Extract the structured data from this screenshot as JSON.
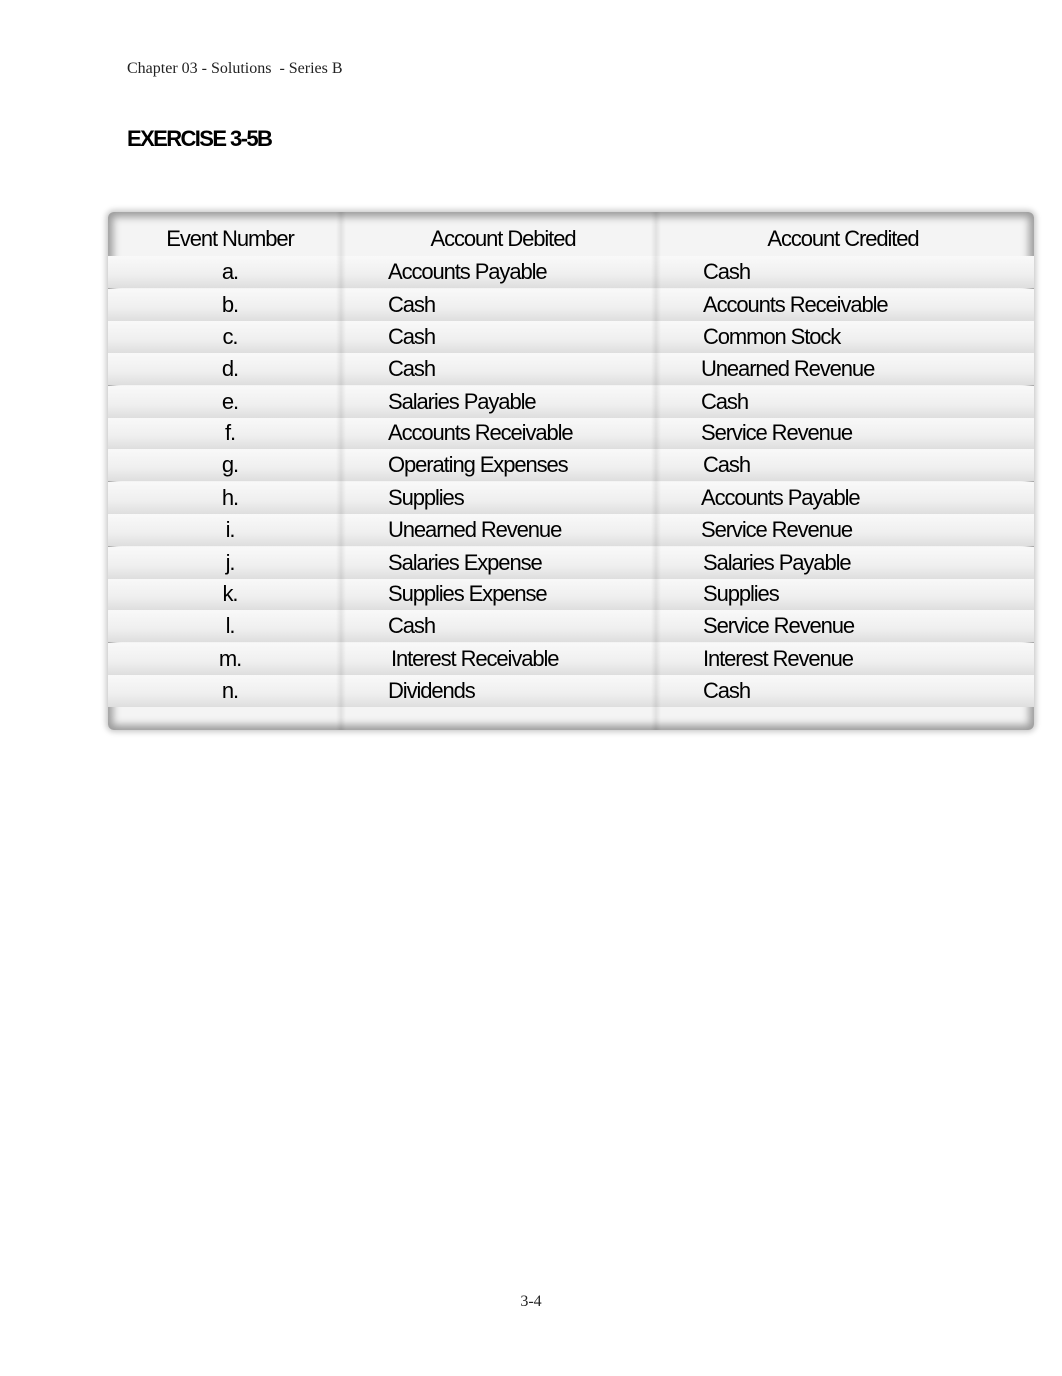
{
  "header": {
    "text": "Chapter 03 - Solutions  - Series B"
  },
  "exercise": {
    "title": "EXERCISE 3-5B"
  },
  "table": {
    "columns": [
      "Event Number",
      "Account Debited",
      "Account Credited"
    ],
    "rows": [
      {
        "event": "a.",
        "debited": "Accounts Payable",
        "credited": "Cash"
      },
      {
        "event": "b.",
        "debited": "Cash",
        "credited": "Accounts Receivable"
      },
      {
        "event": "c.",
        "debited": "Cash",
        "credited": "Common Stock"
      },
      {
        "event": "d.",
        "debited": "Cash",
        "credited": "Unearned Revenue"
      },
      {
        "event": "e.",
        "debited": "Salaries Payable",
        "credited": "Cash"
      },
      {
        "event": "f.",
        "debited": "Accounts Receivable",
        "credited": "Service Revenue"
      },
      {
        "event": "g.",
        "debited": "Operating Expenses",
        "credited": "Cash"
      },
      {
        "event": "h.",
        "debited": "Supplies",
        "credited": "Accounts Payable"
      },
      {
        "event": "i.",
        "debited": "Unearned Revenue",
        "credited": "Service Revenue"
      },
      {
        "event": "j.",
        "debited": "Salaries Expense",
        "credited": "Salaries Payable"
      },
      {
        "event": "k.",
        "debited": "Supplies Expense",
        "credited": "Supplies"
      },
      {
        "event": "l.",
        "debited": "Cash",
        "credited": "Service Revenue"
      },
      {
        "event": "m.",
        "debited": "Interest Receivable",
        "credited": "Interest Revenue"
      },
      {
        "event": "n.",
        "debited": "Dividends",
        "credited": "Cash"
      }
    ]
  },
  "footer": {
    "page_number": "3-4"
  }
}
